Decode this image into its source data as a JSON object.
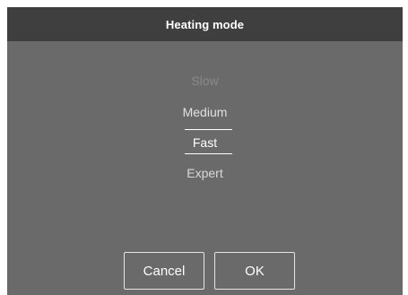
{
  "dialog": {
    "title": "Heating mode",
    "options": [
      {
        "label": "Slow",
        "state": "faded"
      },
      {
        "label": "Medium",
        "state": "normal"
      },
      {
        "label": "Fast",
        "state": "selected"
      },
      {
        "label": "Expert",
        "state": "normal"
      }
    ],
    "selected": "Fast",
    "buttons": {
      "cancel_label": "Cancel",
      "ok_label": "OK"
    }
  },
  "colors": {
    "title_bar": "#3f3f3f",
    "dialog_bg": "#6a6a6a",
    "text_selected": "#ffffff",
    "text_faded": "#8a8a8a"
  }
}
